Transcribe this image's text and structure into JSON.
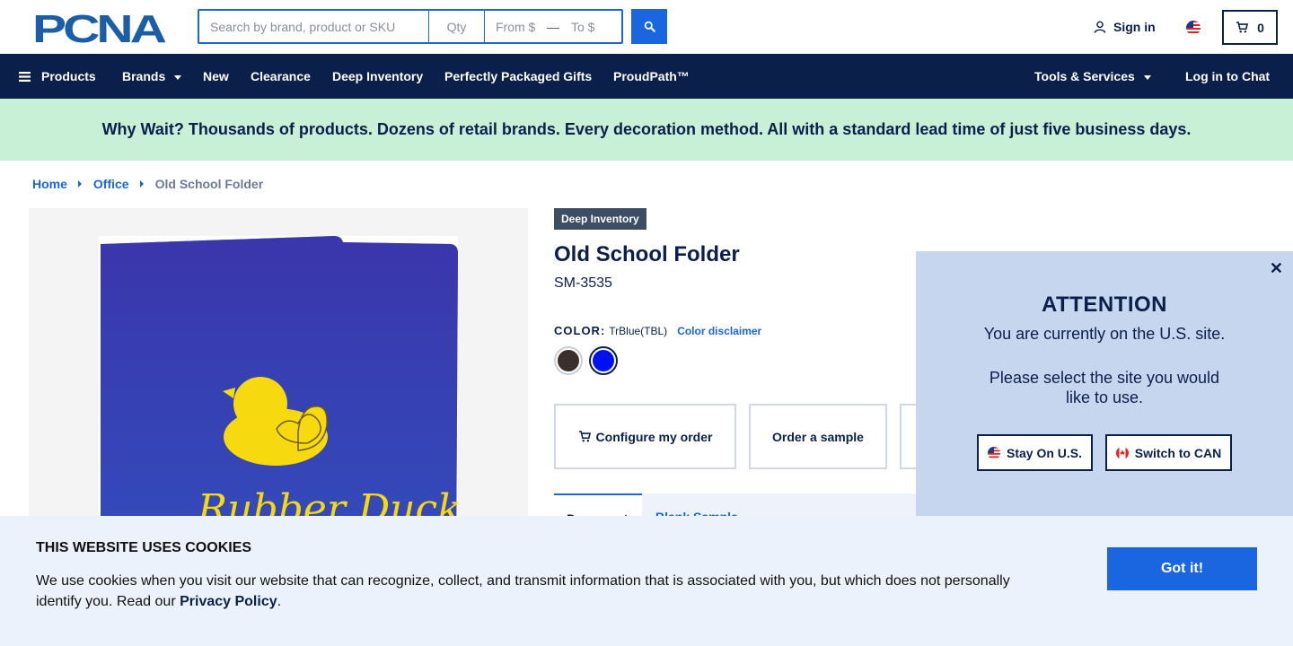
{
  "header": {
    "logo_text": "PCNA",
    "search": {
      "placeholder": "Search by brand, product or SKU",
      "qty_placeholder": "Qty",
      "from_placeholder": "From $",
      "to_placeholder": "To $"
    },
    "sign_in": "Sign in",
    "cart_count": "0"
  },
  "nav": {
    "products": "Products",
    "brands": "Brands",
    "new": "New",
    "clearance": "Clearance",
    "deep_inventory": "Deep Inventory",
    "gifts": "Perfectly Packaged Gifts",
    "proudpath": "ProudPath™",
    "tools": "Tools & Services",
    "chat": "Log in to Chat"
  },
  "banner": "Why Wait? Thousands of products. Dozens of retail brands. Every decoration method. All with a standard lead time of just five business days.",
  "breadcrumb": {
    "home": "Home",
    "category": "Office",
    "current": "Old School Folder"
  },
  "product": {
    "badge": "Deep Inventory",
    "title": "Old School Folder",
    "sku": "SM-3535",
    "color_label": "COLOR:",
    "color_value": "TrBlue(TBL)",
    "color_disclaimer": "Color disclaimer",
    "swatches": [
      {
        "name": "black",
        "color": "#3b2f2a"
      },
      {
        "name": "blue",
        "color": "#0010f0"
      }
    ],
    "imprint_text": "Rubber Duck",
    "configure": "Configure my order",
    "sample": "Order a sample",
    "tab_1": "Document",
    "tab_2": "Blank Sample"
  },
  "modal": {
    "title": "ATTENTION",
    "line1": "You are currently on the U.S. site.",
    "line2": "Please select the site you would like to use.",
    "stay": "Stay On U.S.",
    "switch": "Switch to CAN"
  },
  "cookies": {
    "title": "THIS WEBSITE USES COOKIES",
    "text": "We use cookies when you visit our website that can recognize, collect, and transmit information that is associated with you, but which does not personally identify you. Read our ",
    "policy": "Privacy Policy",
    "period": ".",
    "button": "Got it!"
  },
  "colors": {
    "navy": "#0b1f4b",
    "accent": "#1a66e0",
    "banner_bg": "#c7f0d6"
  }
}
